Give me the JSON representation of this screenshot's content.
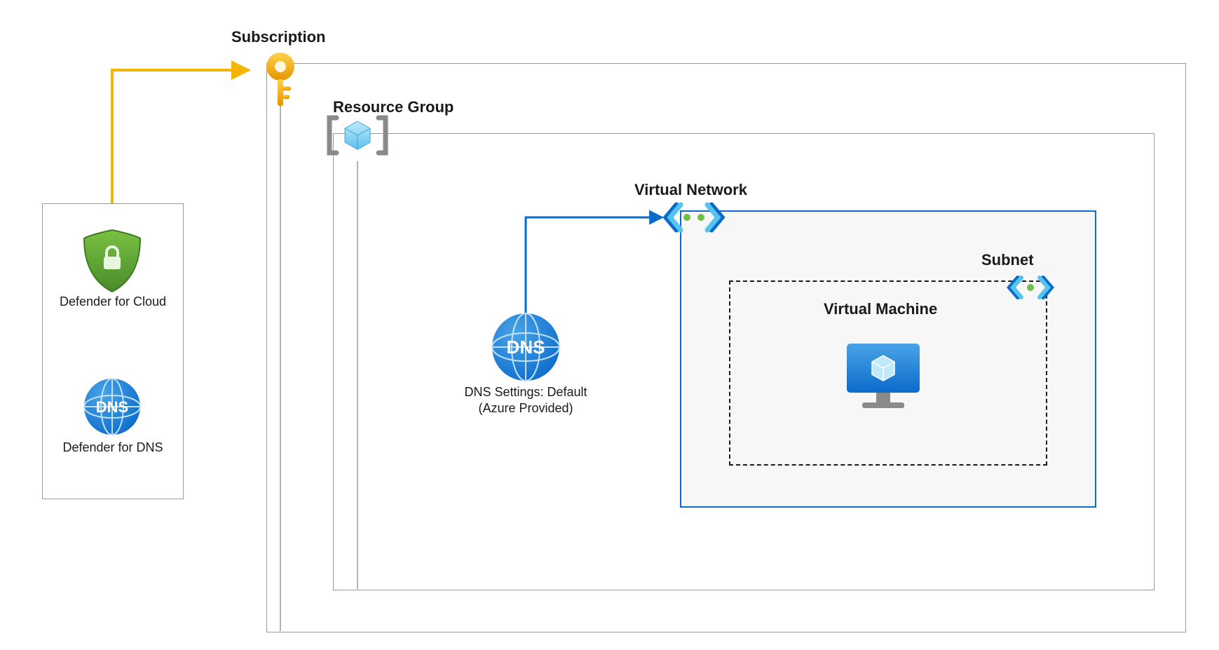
{
  "labels": {
    "subscription": "Subscription",
    "resource_group": "Resource Group",
    "virtual_network": "Virtual Network",
    "subnet": "Subnet",
    "virtual_machine": "Virtual Machine",
    "defender_cloud": "Defender for Cloud",
    "defender_dns": "Defender for DNS",
    "dns_line1": "DNS Settings: Default",
    "dns_line2": "(Azure Provided)",
    "dns_icon_text": "DNS"
  },
  "colors": {
    "azure_blue": "#0b6bcb",
    "light_blue": "#59c3ef",
    "key_yellow": "#f5b400",
    "green": "#57a639",
    "green_dot": "#6fbf44"
  }
}
